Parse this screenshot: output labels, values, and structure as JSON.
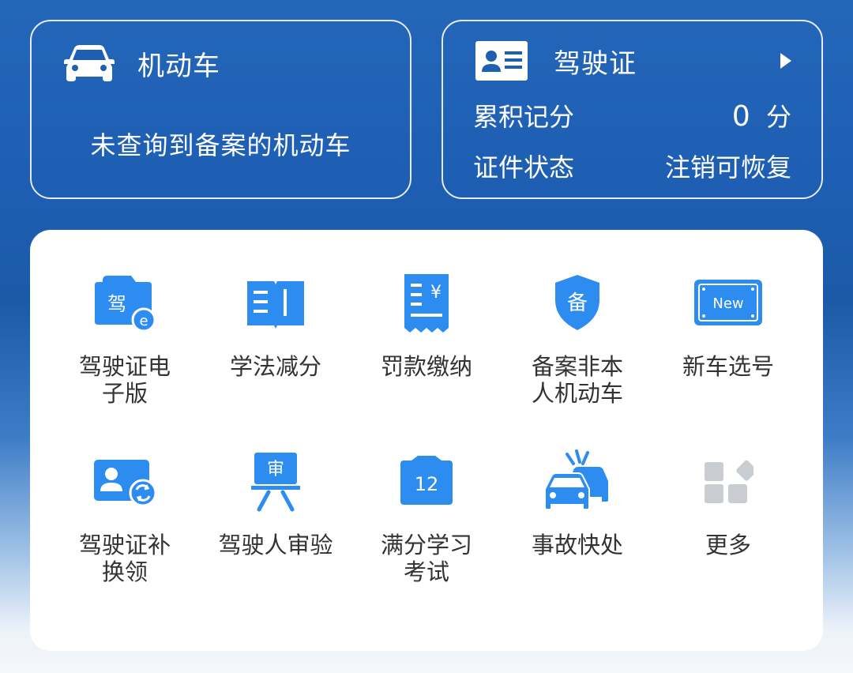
{
  "colors": {
    "accent_blue": "#2d8cf0",
    "card_text": "#ffffff",
    "label_text": "#333333",
    "more_gray": "#c9ccd1"
  },
  "vehicle_card": {
    "icon": "car-icon",
    "title": "机动车",
    "message": "未查询到备案的机动车"
  },
  "license_card": {
    "icon": "id-card-icon",
    "title": "驾驶证",
    "arrow_icon": "chevron-right-icon",
    "points_label": "累积记分",
    "points_value": "0",
    "points_unit": "分",
    "status_label": "证件状态",
    "status_value": "注销可恢复"
  },
  "services": [
    {
      "label": "驾驶证电\n子版",
      "icon": "e-license-icon"
    },
    {
      "label": "学法减分",
      "icon": "book-icon"
    },
    {
      "label": "罚款缴纳",
      "icon": "receipt-icon"
    },
    {
      "label": "备案非本\n人机动车",
      "icon": "shield-icon"
    },
    {
      "label": "新车选号",
      "icon": "new-plate-icon"
    },
    {
      "label": "驾驶证补\n换领",
      "icon": "license-replace-icon"
    },
    {
      "label": "驾驶人审验",
      "icon": "review-icon"
    },
    {
      "label": "满分学习\n考试",
      "icon": "calendar-icon"
    },
    {
      "label": "事故快处",
      "icon": "accident-icon"
    },
    {
      "label": "更多",
      "icon": "more-icon"
    }
  ],
  "icon_text": {
    "e_license_char": "驾",
    "e_badge": "e",
    "receipt_symbol": "¥",
    "shield_char": "备",
    "new_plate": "New",
    "review_char": "审",
    "calendar_number": "12"
  }
}
